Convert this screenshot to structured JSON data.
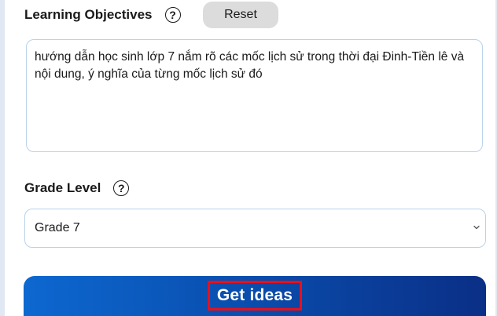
{
  "learning_objectives": {
    "label": "Learning Objectives",
    "help_icon": "?",
    "reset_label": "Reset",
    "value": "hướng dẫn học sinh lớp 7 nắm rõ các mốc lịch sử trong thời đại Đinh-Tiền lê và nội dung, ý nghĩa của từng mốc lịch sử đó"
  },
  "grade_level": {
    "label": "Grade Level",
    "help_icon": "?",
    "selected": "Grade 7"
  },
  "actions": {
    "get_ideas_label": "Get ideas"
  },
  "colors": {
    "cta_gradient_start": "#0d68d0",
    "cta_gradient_end": "#0a2f86",
    "highlight_border": "#e8101b",
    "field_border": "#b9d2ea",
    "reset_bg": "#dcdcdc"
  },
  "icons": {
    "help": "question-circle-icon",
    "select_arrow": "chevron-down-icon"
  }
}
